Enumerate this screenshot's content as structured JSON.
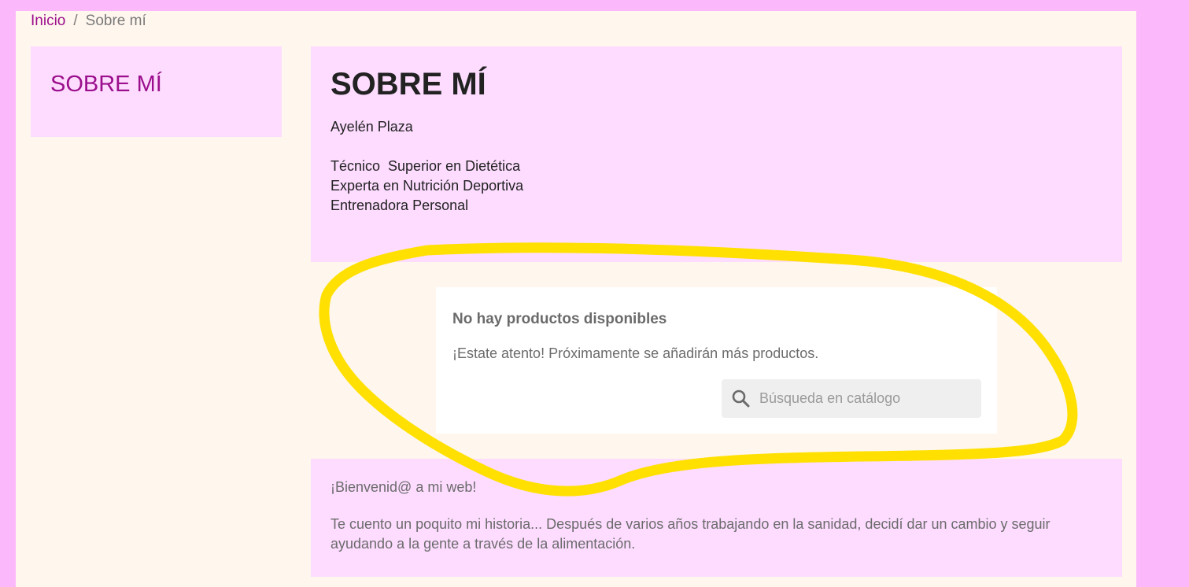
{
  "breadcrumb": {
    "home": "Inicio",
    "separator": "/",
    "current": "Sobre mí"
  },
  "sidebar": {
    "title": "SOBRE MÍ"
  },
  "main": {
    "title": "SOBRE MÍ",
    "lines": [
      "Ayelén Plaza",
      "",
      "Técnico  Superior en Dietética",
      "Experta en Nutrición Deportiva",
      "Entrenadora Personal"
    ]
  },
  "products": {
    "title": "No hay productos disponibles",
    "subtitle": "¡Estate atento! Próximamente se añadirán más productos.",
    "search_placeholder": "Búsqueda en catálogo",
    "search_value": ""
  },
  "welcome": {
    "heading": "¡Bienvenid@ a mi web!",
    "body": "Te cuento un poquito mi historia... Después de varios años trabajando en la sanidad, decidí dar un cambio y seguir ayudando a la gente a través de la alimentación."
  },
  "colors": {
    "background": "#fbb8fb",
    "page": "#fff6ed",
    "panel": "#fddcff",
    "accent": "#9b0f8c",
    "highlight_stroke": "#ffe000"
  },
  "icons": {
    "search": "search-icon"
  }
}
